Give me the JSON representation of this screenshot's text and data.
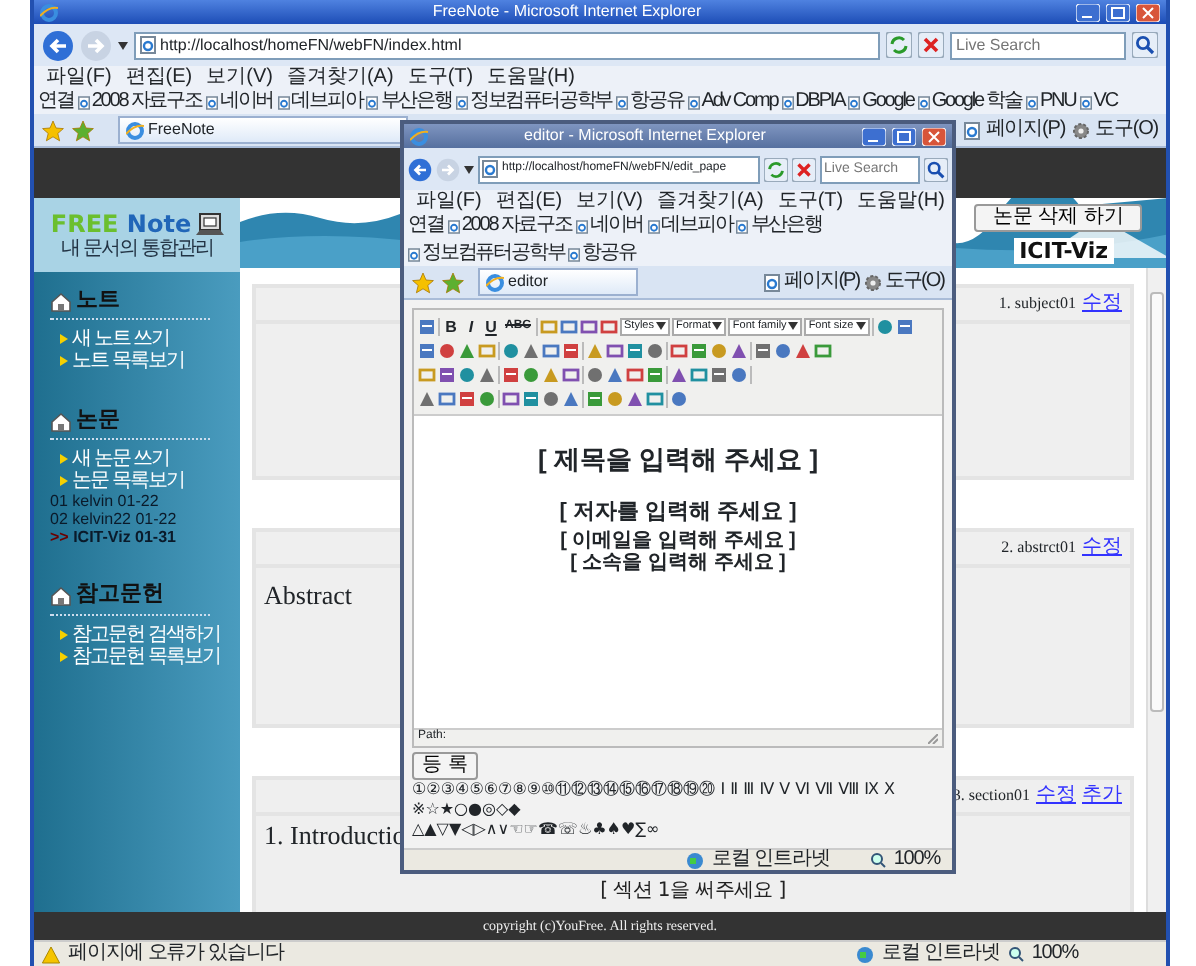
{
  "browser": {
    "title": "FreeNote - Microsoft Internet Explorer",
    "address": "http://localhost/homeFN/webFN/index.html",
    "search_placeholder": "Live Search",
    "menu": [
      "파일(F)",
      "편집(E)",
      "보기(V)",
      "즐겨찾기(A)",
      "도구(T)",
      "도움말(H)"
    ],
    "links_label": "연결",
    "links": [
      "2008 자료구조",
      "네이버",
      "데브피아",
      "부산은행",
      "정보컴퓨터공학부",
      "항공유",
      "Adv Comp",
      "DBPIA",
      "Google",
      "Google 학술",
      "PNU",
      "VC"
    ],
    "tab": "FreeNote",
    "commands": [
      "페이지(P)",
      "도구(O)"
    ],
    "status_text": "페이지에 오류가 있습니다",
    "status_zone": "로컬 인트라넷",
    "zoom": "100%"
  },
  "page": {
    "logo_words": [
      "FREE",
      "Note"
    ],
    "logo_subtitle": "내 문서의 통합관리",
    "sidebar": [
      {
        "title": "노트",
        "links": [
          "새 노트 쓰기",
          "노트 목록보기"
        ]
      },
      {
        "title": "논문",
        "links": [
          "새 논문 쓰기",
          "논문 목록보기"
        ],
        "papers": [
          {
            "prefix": "01",
            "label": "kelvin 01-22",
            "selected": false
          },
          {
            "prefix": "02",
            "label": "kelvin22 01-22",
            "selected": false
          },
          {
            "prefix": ">>",
            "label": "ICIT-Viz 01-31",
            "selected": true
          }
        ]
      },
      {
        "title": "참고문헌",
        "links": [
          "참고문헌 검색하기",
          "참고문헌 목록보기"
        ]
      }
    ],
    "delete_button": "논문 삭제 하기",
    "paper_title": "ICIT-Viz",
    "sections": [
      {
        "heading": "1. subject01",
        "links": [
          "수정"
        ]
      },
      {
        "heading": "2. abstrct01",
        "links": [
          "수정"
        ],
        "body": "Abstract"
      },
      {
        "heading": "3. section01",
        "links": [
          "수정",
          "추가"
        ],
        "body": "1. Introductio",
        "note": "[ 섹션 1을 써주세요 ]"
      }
    ],
    "footer": "copyright (c)YouFree. All rights reserved."
  },
  "popup": {
    "title": "editor - Microsoft Internet Explorer",
    "address": "http://localhost/homeFN/webFN/edit_pape",
    "search_placeholder": "Live Search",
    "menu": [
      "파일(F)",
      "편집(E)",
      "보기(V)",
      "즐겨찾기(A)",
      "도구(T)",
      "도움말(H)"
    ],
    "links_label": "연결",
    "links": [
      "2008 자료구조",
      "네이버",
      "데브피아",
      "부산은행",
      "정보컴퓨터공학부",
      "항공유"
    ],
    "tab": "editor",
    "commands": [
      "페이지(P)",
      "도구(O)"
    ],
    "editor": {
      "format_buttons": [
        "B",
        "I",
        "U",
        "ABC"
      ],
      "selects": [
        "Styles",
        "Format",
        "Font family",
        "Font size"
      ],
      "content": [
        {
          "kind": "title",
          "text": "[ 제목을 입력해 주세요 ]"
        },
        {
          "kind": "author",
          "text": "[ 저자를 입력해 주세요 ]"
        },
        {
          "kind": "meta",
          "text": "[ 이메일을 입력해 주세요 ]"
        },
        {
          "kind": "meta",
          "text": "[ 소속을 입력해 주세요 ]"
        }
      ],
      "path_label": "Path:"
    },
    "submit_button": "등 록",
    "symbols": [
      "①②③④⑤⑥⑦⑧⑨⑩⑪⑫⑬⑭⑮⑯⑰⑱⑲⑳ Ⅰ Ⅱ Ⅲ Ⅳ Ⅴ Ⅵ Ⅶ Ⅷ Ⅸ Ⅹ ※☆★○●◎◇◆",
      "△▲▽▼◁▷∧∨☜☞☎☏♨♣♠♥∑∞"
    ],
    "status_zone": "로컬 인트라넷",
    "zoom": "100%"
  }
}
